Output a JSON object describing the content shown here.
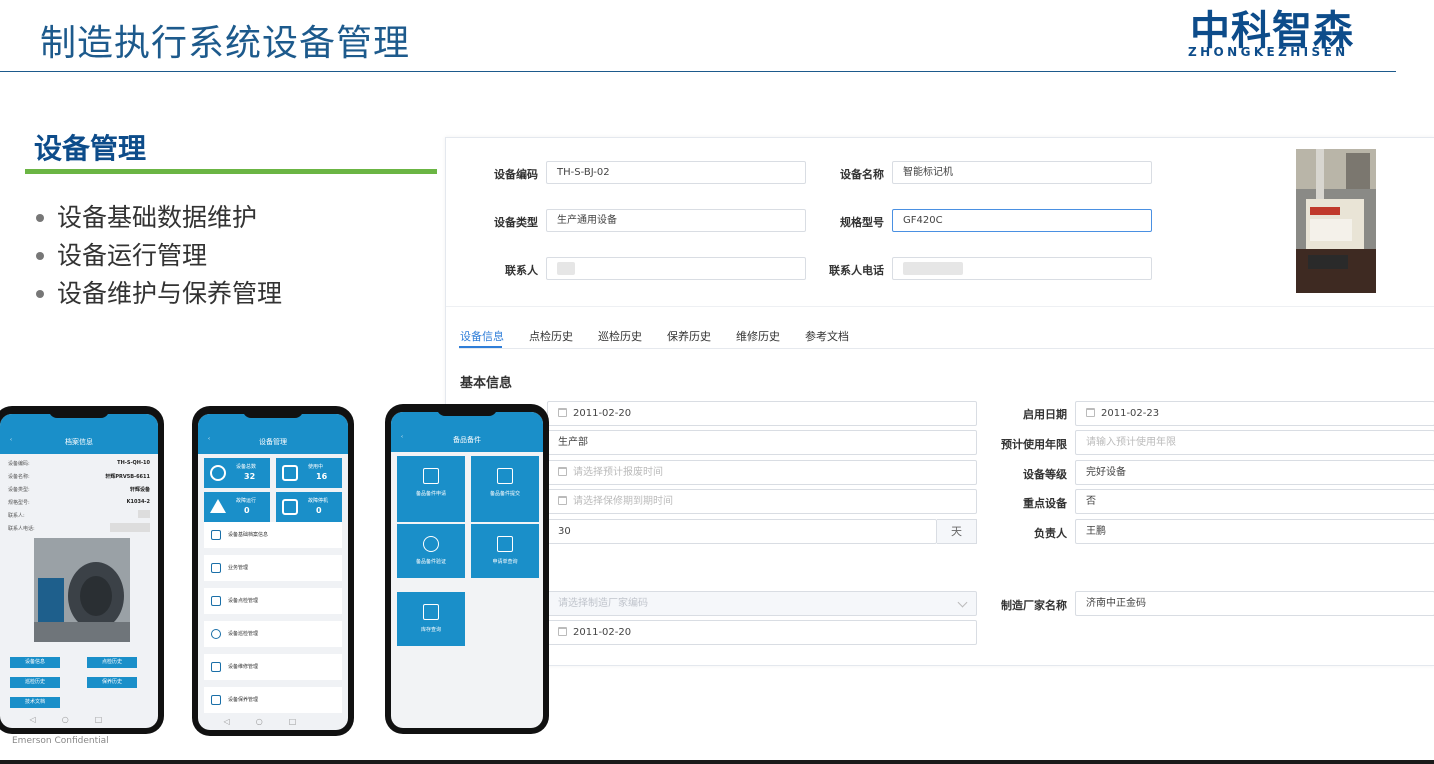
{
  "slide": {
    "title": "制造执行系统设备管理",
    "logo_cn": "中科智森",
    "logo_en": "ZHONGKEZHISEN",
    "footer": "Emerson Confidential"
  },
  "left": {
    "heading": "设备管理",
    "bullets": [
      "设备基础数据维护",
      "设备运行管理",
      "设备维护与保养管理"
    ]
  },
  "desktop": {
    "header_fields": {
      "device_code_label": "设备编码",
      "device_code_value": "TH-S-BJ-02",
      "device_name_label": "设备名称",
      "device_name_value": "智能标记机",
      "device_type_label": "设备类型",
      "device_type_value": "生产通用设备",
      "model_label": "规格型号",
      "model_value": "GF420C",
      "contact_label": "联系人",
      "contact_phone_label": "联系人电话"
    },
    "tabs": [
      "设备信息",
      "点检历史",
      "巡检历史",
      "保养历史",
      "维修历史",
      "参考文档"
    ],
    "active_tab": "设备信息",
    "basic_info_title": "基本信息",
    "left_values": {
      "row1": "2011-02-20",
      "row2": "生产部",
      "row3_placeholder": "请选择预计报废时间",
      "row4_placeholder": "请选择保修期到期时间",
      "row5": "30",
      "row5_unit": "天",
      "row6_placeholder": "请选择制造厂家编码",
      "row7": "2011-02-20"
    },
    "right_fields": {
      "start_date_label": "启用日期",
      "start_date_value": "2011-02-23",
      "life_label": "预计使用年限",
      "life_placeholder": "请输入预计使用年限",
      "grade_label": "设备等级",
      "grade_value": "完好设备",
      "key_label": "重点设备",
      "key_value": "否",
      "owner_label": "负责人",
      "owner_value": "王鹏",
      "maker_label": "制造厂家名称",
      "maker_value": "济南中正金码"
    }
  },
  "phone1": {
    "title": "档案信息",
    "rows": [
      {
        "k": "设备编码:",
        "v": "TH-S-QH-10"
      },
      {
        "k": "设备名称:",
        "v": "轩辉PRV5B-6611"
      },
      {
        "k": "设备类型:",
        "v": "轩辉设备"
      },
      {
        "k": "规格型号:",
        "v": "K1034-2"
      },
      {
        "k": "联系人:",
        "v": ""
      },
      {
        "k": "联系人电话:",
        "v": ""
      }
    ],
    "buttons": [
      "设备信息",
      "点检历史",
      "巡检历史",
      "保养历史",
      "技术文档"
    ]
  },
  "phone2": {
    "title": "设备管理",
    "stats": [
      {
        "label": "设备总数",
        "value": "32"
      },
      {
        "label": "使用中",
        "value": "16"
      },
      {
        "label": "故障运行",
        "value": "0"
      },
      {
        "label": "故障停机",
        "value": "0"
      }
    ],
    "menu": [
      "设备基础档案信息",
      "业务管理",
      "设备点检管理",
      "设备巡检管理",
      "设备维修管理",
      "设备保养管理"
    ]
  },
  "phone3": {
    "title": "备品备件",
    "tiles": [
      "备品备件申请",
      "备品备件提交",
      "备品备件验证",
      "申请单查询",
      "库存查询"
    ]
  },
  "colors": {
    "title_blue": "#1d5a8c",
    "logo_blue": "#0d4c8a",
    "green_rule": "#6bb544",
    "app_blue": "#1a8fc9",
    "tab_active": "#2f7ed8"
  }
}
